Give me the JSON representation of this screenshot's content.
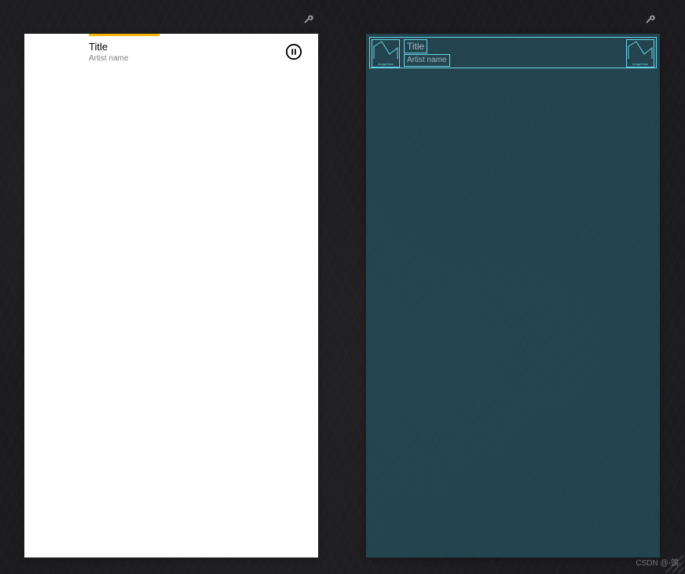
{
  "preview": {
    "title": "Title",
    "artist": "Artist name"
  },
  "blueprint": {
    "title": "Title",
    "artist": "Artist name",
    "imageview_label": "ImageView"
  },
  "watermark": "CSDN @-鵼"
}
